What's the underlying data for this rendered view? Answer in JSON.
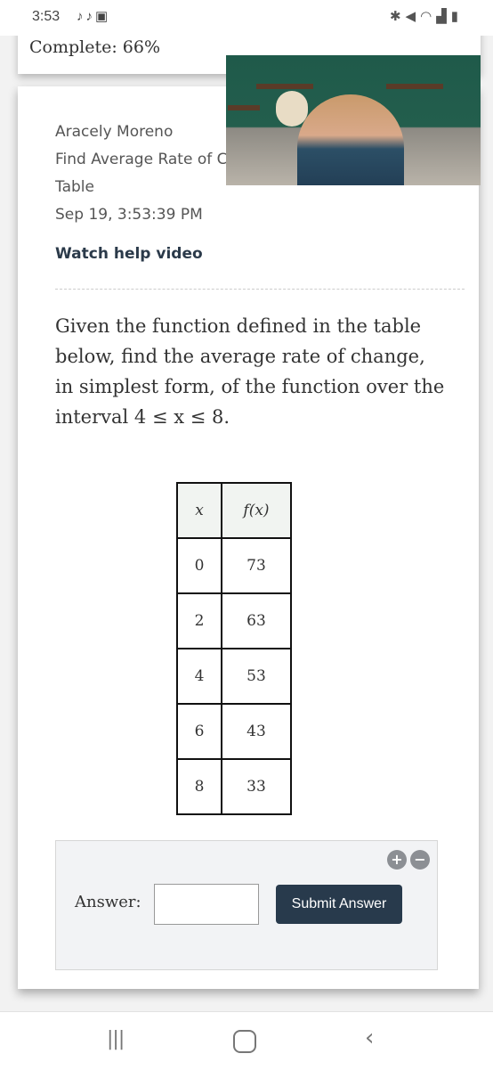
{
  "status_bar": {
    "time": "3:53",
    "left_icons": [
      "tiktok-icon",
      "tiktok-icon",
      "gallery-icon"
    ],
    "right_icons": [
      "bluetooth-icon",
      "mute-icon",
      "wifi-icon",
      "signal-icon",
      "battery-icon"
    ]
  },
  "progress": {
    "label": "Complete: 66%",
    "percent": 66
  },
  "meta": {
    "student_name": "Aracely Moreno",
    "assignment_title": "Find Average Rate of C",
    "assignment_title_line2": "Table",
    "timestamp": "Sep 19, 3:53:39 PM",
    "help_link": "Watch help video"
  },
  "question": {
    "text_part1": "Given the function defined in the table below, find the average rate of change, in simplest form, of the function over the interval ",
    "interval": "4 ≤ x ≤ 8."
  },
  "table": {
    "headers": [
      "x",
      "f(x)"
    ],
    "rows": [
      [
        "0",
        "73"
      ],
      [
        "2",
        "63"
      ],
      [
        "4",
        "53"
      ],
      [
        "6",
        "43"
      ],
      [
        "8",
        "33"
      ]
    ]
  },
  "answer": {
    "label": "Answer:",
    "value": "",
    "submit_label": "Submit Answer",
    "plus_symbol": "+",
    "minus_symbol": "−"
  },
  "nav_bar": {
    "recent": "|||",
    "back": "‹"
  }
}
